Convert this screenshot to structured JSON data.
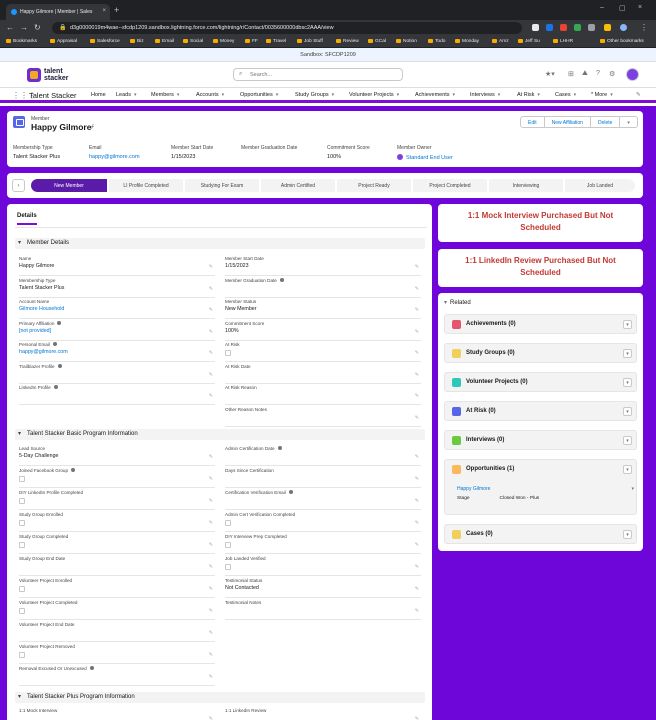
{
  "browser": {
    "tab_title": "Happy Gilmore | Member | Sales",
    "url": "d3g0000019m4wae--sfcdp1209.sandbox.lightning.force.com/lightning/r/Contact/0035600000dbsc2AAA/view",
    "bookmarks": [
      "Bookmarks",
      "Appraisal",
      "Salesforce",
      "Biz",
      "Email",
      "Social",
      "Money",
      "FF",
      "Travel",
      "Job Stuff",
      "Review",
      "GCal",
      "Notion",
      "Todo",
      "Monday",
      "Amz",
      "Jeff Su",
      "LHHR",
      "Other bookmarks"
    ]
  },
  "sandbox_banner": "Sandbox: SFCDP1209",
  "header": {
    "logo_line1": "talent",
    "logo_line2": "stacker",
    "search_placeholder": "Search..."
  },
  "nav": {
    "app_name": "Talent Stacker",
    "items": [
      "Home",
      "Leads",
      "Members",
      "Accounts",
      "Opportunities",
      "Study Groups",
      "Volunteer Projects",
      "Achievements",
      "Interviews",
      "At Risk",
      "Cases",
      "* More"
    ]
  },
  "record": {
    "type_label": "Member",
    "name": "Happy Gilmore",
    "buttons": [
      "Edit",
      "New Affiliation",
      "Delete",
      "▾"
    ],
    "highlights": [
      {
        "label": "Membership Type",
        "value": "Talent Stacker Plus",
        "link": false
      },
      {
        "label": "Email",
        "value": "happy@gilmore.com",
        "link": true
      },
      {
        "label": "Member Start Date",
        "value": "1/15/2023",
        "link": false
      },
      {
        "label": "Member Graduation Date",
        "value": "",
        "link": false
      },
      {
        "label": "Commitment Score",
        "value": "100%",
        "link": false
      },
      {
        "label": "Member Owner",
        "value": "Standard End User",
        "link": true
      }
    ]
  },
  "path": {
    "steps": [
      "New Member",
      "LI Profile Completed",
      "Studying For Exam",
      "Admin Certified",
      "Project Ready",
      "Project Completed",
      "Interviewing",
      "Job Landed"
    ],
    "current": 0
  },
  "details": {
    "tab": "Details",
    "sections": {
      "member_details": "Member Details",
      "basic_program": "Talent Stacker Basic Program Information",
      "plus_program": "Talent Stacker Plus Program Information"
    },
    "member_details_left": [
      {
        "label": "Name",
        "value": "Happy Gilmore"
      },
      {
        "label": "Membership Type",
        "value": "Talent Stacker Plus"
      },
      {
        "label": "Account Name",
        "value": "Gilmore Household",
        "link": true
      },
      {
        "label": "Primary Affiliation",
        "value": "[not provided]",
        "link": true
      },
      {
        "label": "Personal Email",
        "value": "happy@gilmore.com",
        "link": true
      },
      {
        "label": "Trailblazer Profile",
        "value": ""
      },
      {
        "label": "LinkedIn Profile",
        "value": ""
      }
    ],
    "member_details_right": [
      {
        "label": "Member Start Date",
        "value": "1/15/2023"
      },
      {
        "label": "Member Graduation Date",
        "value": ""
      },
      {
        "label": "Member Status",
        "value": "New Member"
      },
      {
        "label": "Commitment Score",
        "value": "100%"
      },
      {
        "label": "At Risk",
        "value": "",
        "checkbox": true
      },
      {
        "label": "At Risk Date",
        "value": ""
      },
      {
        "label": "At Risk Reason",
        "value": ""
      },
      {
        "label": "Other Reason Notes",
        "value": ""
      }
    ],
    "basic_left": [
      {
        "label": "Lead Source",
        "value": "5-Day Challenge"
      },
      {
        "label": "Joined Facebook Group",
        "value": "",
        "checkbox": true
      },
      {
        "label": "DIY LinkedIn Profile Completed",
        "value": "",
        "checkbox": true
      },
      {
        "label": "Study Group Enrolled",
        "value": "",
        "checkbox": true
      },
      {
        "label": "Study Group Completed",
        "value": "",
        "checkbox": true
      },
      {
        "label": "Study Group End Date",
        "value": ""
      },
      {
        "label": "Volunteer Project Enrolled",
        "value": "",
        "checkbox": true
      },
      {
        "label": "Volunteer Project Completed",
        "value": "",
        "checkbox": true
      },
      {
        "label": "Volunteer Project End Date",
        "value": ""
      },
      {
        "label": "Volunteer Project Removed",
        "value": "",
        "checkbox": true
      },
      {
        "label": "Removal Excused Or Unexcused",
        "value": ""
      }
    ],
    "basic_right": [
      {
        "label": "Admin Certification Date",
        "value": ""
      },
      {
        "label": "Days Since Certification",
        "value": ""
      },
      {
        "label": "Certification Verification Email",
        "value": ""
      },
      {
        "label": "Admin Cert Verification Completed",
        "value": "",
        "checkbox": true
      },
      {
        "label": "DIY Interview Prep Completed",
        "value": "",
        "checkbox": true
      },
      {
        "label": "Job Landed Verified",
        "value": "",
        "checkbox": true
      },
      {
        "label": "Testimonial Status",
        "value": "Not Contacted"
      },
      {
        "label": "Testimonial Notes",
        "value": ""
      }
    ],
    "plus_left": [
      {
        "label": "1:1 Mock Interview",
        "value": ""
      }
    ],
    "plus_right": [
      {
        "label": "1:1 LinkedIn Review",
        "value": ""
      }
    ]
  },
  "alerts": [
    "1:1 Mock Interview Purchased But Not Scheduled",
    "1:1 LinkedIn Review Purchased But Not Scheduled"
  ],
  "related": {
    "title": "Related",
    "lists": [
      {
        "title": "Achievements (0)",
        "color": "#e3566e"
      },
      {
        "title": "Study Groups (0)",
        "color": "#f2cf5b"
      },
      {
        "title": "Volunteer Projects (0)",
        "color": "#2dc9b8"
      },
      {
        "title": "At Risk (0)",
        "color": "#5867e8"
      },
      {
        "title": "Interviews (0)",
        "color": "#6ac93e"
      },
      {
        "title": "Opportunities (1)",
        "color": "#fcb95b"
      },
      {
        "title": "Cases (0)",
        "color": "#f2cf5b"
      }
    ],
    "opportunity": {
      "name": "Happy Gilmore",
      "stage_label": "Stage",
      "stage_value": "Closed Won - Plus"
    }
  },
  "colors": {
    "brand": "#6f06d9",
    "active": "#5a1ba9",
    "link": "#0176d3",
    "alert": "#c23934"
  }
}
